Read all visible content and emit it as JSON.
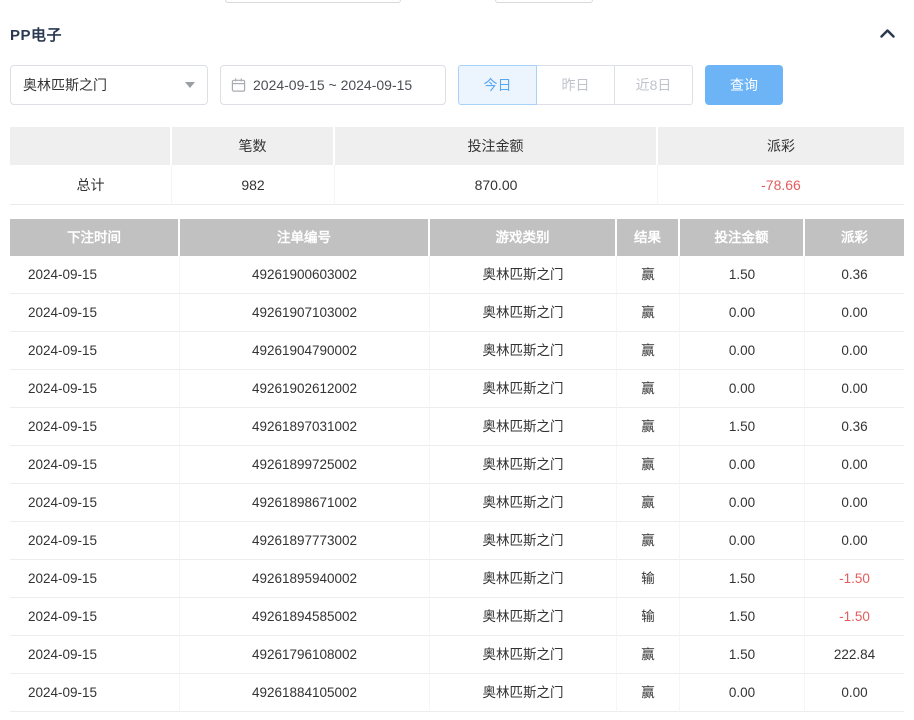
{
  "section": {
    "title": "PP电子"
  },
  "filters": {
    "game_select": {
      "value": "奥林匹斯之门"
    },
    "date_range": {
      "value": "2024-09-15 ~ 2024-09-15"
    },
    "quick_buttons": [
      {
        "label": "今日",
        "active": true
      },
      {
        "label": "昨日",
        "active": false
      },
      {
        "label": "近8日",
        "active": false
      }
    ],
    "search_label": "查询"
  },
  "summary": {
    "headers": [
      "",
      "笔数",
      "投注金额",
      "派彩"
    ],
    "total": {
      "label": "总计",
      "count": "982",
      "bet_amount": "870.00",
      "payout": "-78.66"
    }
  },
  "table": {
    "headers": [
      "下注时间",
      "注单编号",
      "游戏类别",
      "结果",
      "投注金额",
      "派彩"
    ],
    "rows": [
      [
        "2024-09-15",
        "49261900603002",
        "奥林匹斯之门",
        "赢",
        "1.50",
        "0.36"
      ],
      [
        "2024-09-15",
        "49261907103002",
        "奥林匹斯之门",
        "赢",
        "0.00",
        "0.00"
      ],
      [
        "2024-09-15",
        "49261904790002",
        "奥林匹斯之门",
        "赢",
        "0.00",
        "0.00"
      ],
      [
        "2024-09-15",
        "49261902612002",
        "奥林匹斯之门",
        "赢",
        "0.00",
        "0.00"
      ],
      [
        "2024-09-15",
        "49261897031002",
        "奥林匹斯之门",
        "赢",
        "1.50",
        "0.36"
      ],
      [
        "2024-09-15",
        "49261899725002",
        "奥林匹斯之门",
        "赢",
        "0.00",
        "0.00"
      ],
      [
        "2024-09-15",
        "49261898671002",
        "奥林匹斯之门",
        "赢",
        "0.00",
        "0.00"
      ],
      [
        "2024-09-15",
        "49261897773002",
        "奥林匹斯之门",
        "赢",
        "0.00",
        "0.00"
      ],
      [
        "2024-09-15",
        "49261895940002",
        "奥林匹斯之门",
        "输",
        "1.50",
        "-1.50"
      ],
      [
        "2024-09-15",
        "49261894585002",
        "奥林匹斯之门",
        "输",
        "1.50",
        "-1.50"
      ],
      [
        "2024-09-15",
        "49261796108002",
        "奥林匹斯之门",
        "赢",
        "1.50",
        "222.84"
      ],
      [
        "2024-09-15",
        "49261884105002",
        "奥林匹斯之门",
        "赢",
        "0.00",
        "0.00"
      ]
    ]
  },
  "colors": {
    "accent": "#6db4f6",
    "active_filter_text": "#58a7f3",
    "negative": "#e35d5d",
    "table_header_bg": "#c1c1c1",
    "table_header_text": "#ffffff",
    "summary_header_bg": "#efefef"
  }
}
